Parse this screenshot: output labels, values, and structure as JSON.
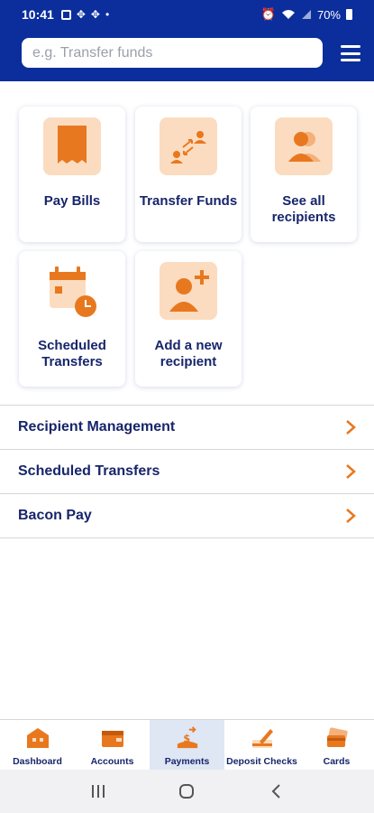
{
  "status": {
    "time": "10:41",
    "battery": "70%"
  },
  "search": {
    "placeholder": "e.g. Transfer funds"
  },
  "tiles": [
    {
      "label": "Pay Bills",
      "icon": "receipt-icon"
    },
    {
      "label": "Transfer Funds",
      "icon": "transfer-people-icon"
    },
    {
      "label": "See all recipients",
      "icon": "recipients-icon"
    },
    {
      "label": "Scheduled Transfers",
      "icon": "calendar-clock-icon"
    },
    {
      "label": "Add a new recipient",
      "icon": "add-person-icon"
    }
  ],
  "list": [
    {
      "label": "Recipient Management"
    },
    {
      "label": "Scheduled Transfers"
    },
    {
      "label": "Bacon Pay"
    }
  ],
  "bottom_nav": [
    {
      "label": "Dashboard",
      "icon": "bank-icon",
      "active": false
    },
    {
      "label": "Accounts",
      "icon": "wallet-icon",
      "active": false
    },
    {
      "label": "Payments",
      "icon": "payment-icon",
      "active": true
    },
    {
      "label": "Deposit Checks",
      "icon": "check-pen-icon",
      "active": false
    },
    {
      "label": "Cards",
      "icon": "cards-icon",
      "active": false
    }
  ],
  "colors": {
    "brand": "#0b2e9c",
    "accent": "#e8781f",
    "accent_light": "#fbdcc0",
    "text": "#17256b"
  }
}
